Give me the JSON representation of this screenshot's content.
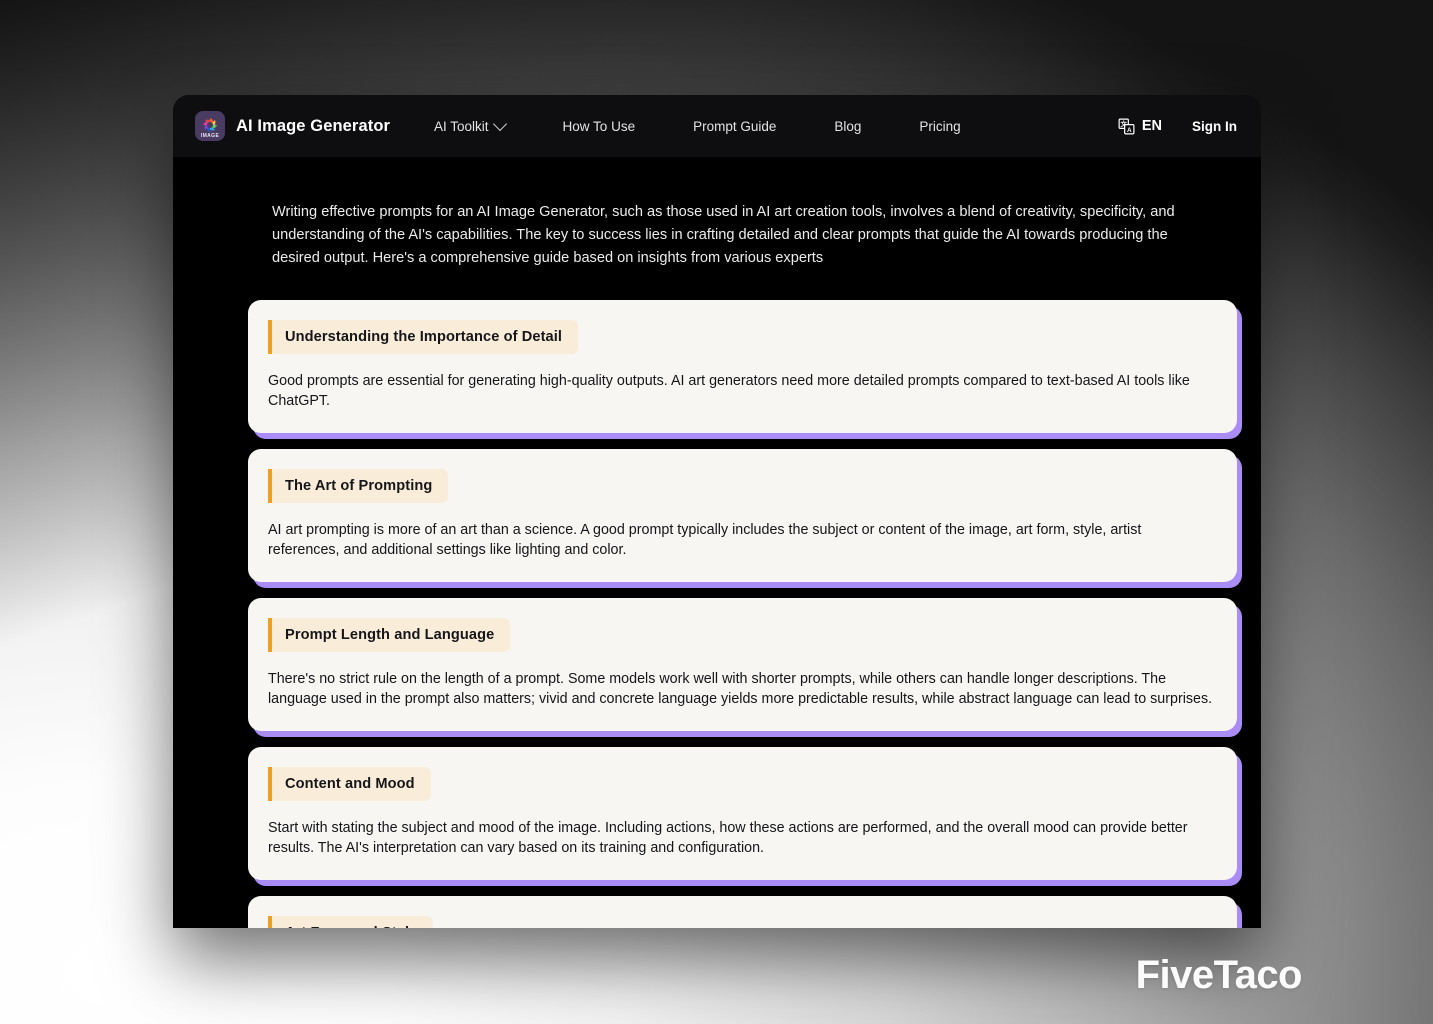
{
  "header": {
    "brand": {
      "logo_icon": "image-flower-logo-icon",
      "logo_word": "IMAGE",
      "name": "AI Image Generator"
    },
    "nav": [
      {
        "label": "AI Toolkit",
        "has_dropdown": true,
        "icon": "chevron-down-icon"
      },
      {
        "label": "How To Use",
        "has_dropdown": false
      },
      {
        "label": "Prompt Guide",
        "has_dropdown": false
      },
      {
        "label": "Blog",
        "has_dropdown": false
      },
      {
        "label": "Pricing",
        "has_dropdown": false
      }
    ],
    "language": {
      "icon": "translate-icon",
      "label": "EN"
    },
    "sign_in_label": "Sign In"
  },
  "main": {
    "intro": "Writing effective prompts for an AI Image Generator, such as those used in AI art creation tools, involves a blend of creativity, specificity, and understanding of the AI's capabilities. The key to success lies in crafting detailed and clear prompts that guide the AI towards producing the desired output. Here's a comprehensive guide based on insights from various experts",
    "cards": [
      {
        "title": "Understanding the Importance of Detail",
        "body": "Good prompts are essential for generating high-quality outputs. AI art generators need more detailed prompts compared to text-based AI tools like ChatGPT."
      },
      {
        "title": "The Art of Prompting",
        "body": "AI art prompting is more of an art than a science. A good prompt typically includes the subject or content of the image, art form, style, artist references, and additional settings like lighting and color."
      },
      {
        "title": "Prompt Length and Language",
        "body": "There's no strict rule on the length of a prompt. Some models work well with shorter prompts, while others can handle longer descriptions. The language used in the prompt also matters; vivid and concrete language yields more predictable results, while abstract language can lead to surprises."
      },
      {
        "title": "Content and Mood",
        "body": "Start with stating the subject and mood of the image. Including actions, how these actions are performed, and the overall mood can provide better results. The AI's interpretation can vary based on its training and configuration."
      },
      {
        "title": "Art Form and Style",
        "body": ""
      }
    ]
  },
  "watermark": {
    "label": "FiveTaco"
  },
  "colors": {
    "header_bg": "#0e0e11",
    "page_bg": "#000000",
    "card_bg": "#f7f6f2",
    "card_shadow": "#a98cf5",
    "title_pill_bg": "#f9edda",
    "title_accent": "#f0a020",
    "text_light": "#ececec",
    "text_dark": "#15151a"
  }
}
